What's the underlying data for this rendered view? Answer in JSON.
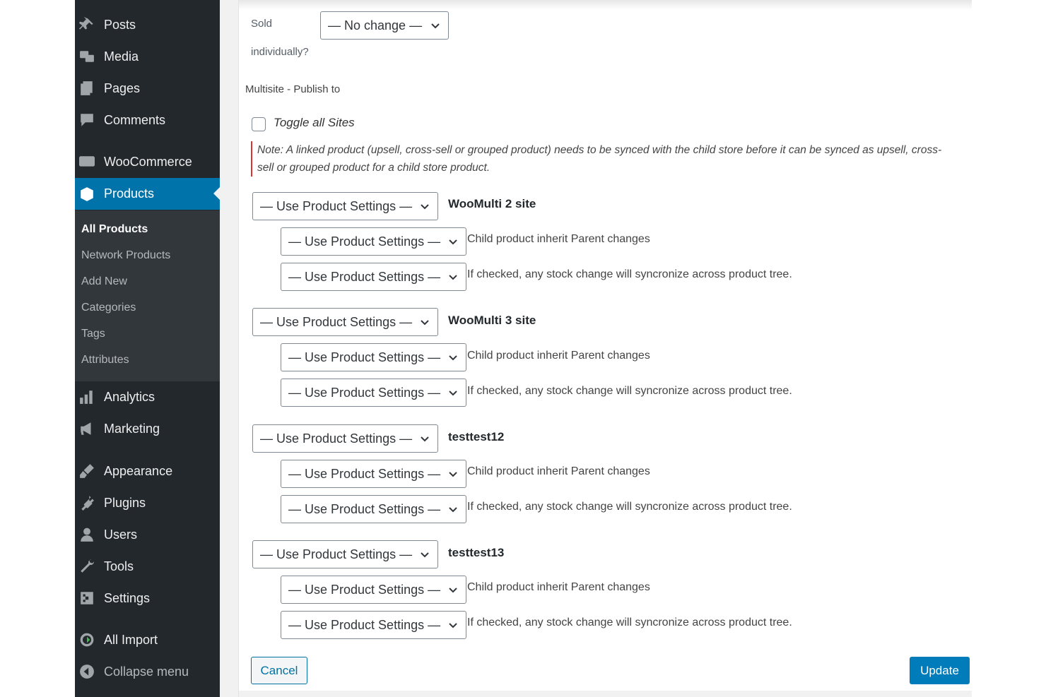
{
  "sidebar": {
    "items": [
      {
        "label": "Posts",
        "icon": "pin-icon"
      },
      {
        "label": "Media",
        "icon": "media-icon"
      },
      {
        "label": "Pages",
        "icon": "pages-icon"
      },
      {
        "label": "Comments",
        "icon": "comment-icon"
      },
      {
        "label": "WooCommerce",
        "icon": "woo-icon"
      },
      {
        "label": "Products",
        "icon": "box-icon"
      },
      {
        "label": "Analytics",
        "icon": "bar-chart-icon"
      },
      {
        "label": "Marketing",
        "icon": "megaphone-icon"
      },
      {
        "label": "Appearance",
        "icon": "brush-icon"
      },
      {
        "label": "Plugins",
        "icon": "plug-icon"
      },
      {
        "label": "Users",
        "icon": "user-icon"
      },
      {
        "label": "Tools",
        "icon": "wrench-icon"
      },
      {
        "label": "Settings",
        "icon": "settings-icon"
      },
      {
        "label": "All Import",
        "icon": "import-icon"
      },
      {
        "label": "Collapse menu",
        "icon": "collapse-icon"
      }
    ],
    "submenu": [
      "All Products",
      "Network Products",
      "Add New",
      "Categories",
      "Tags",
      "Attributes"
    ]
  },
  "form": {
    "sold_label_1": "Sold",
    "sold_label_2": "individually?",
    "sold_value": "— No change —",
    "section_heading": "Multisite - Publish to",
    "toggle_label": "Toggle all Sites",
    "note": "Note: A linked product (upsell, cross-sell or grouped product) needs to be synced with the child store before it can be synced as upsell, cross-sell or grouped product for a child store product.",
    "select_value": "— Use Product Settings —",
    "inherit_desc": "Child product inherit Parent changes",
    "stock_desc": "If checked, any stock change will syncronize across product tree.",
    "sites": [
      "WooMulti 2 site",
      "WooMulti 3 site",
      "testtest12",
      "testtest13"
    ]
  },
  "buttons": {
    "cancel": "Cancel",
    "update": "Update"
  },
  "colors": {
    "sidebar_bg": "#23282d",
    "submenu_bg": "#32373c",
    "accent": "#0073aa",
    "note_border": "#dc3232"
  }
}
